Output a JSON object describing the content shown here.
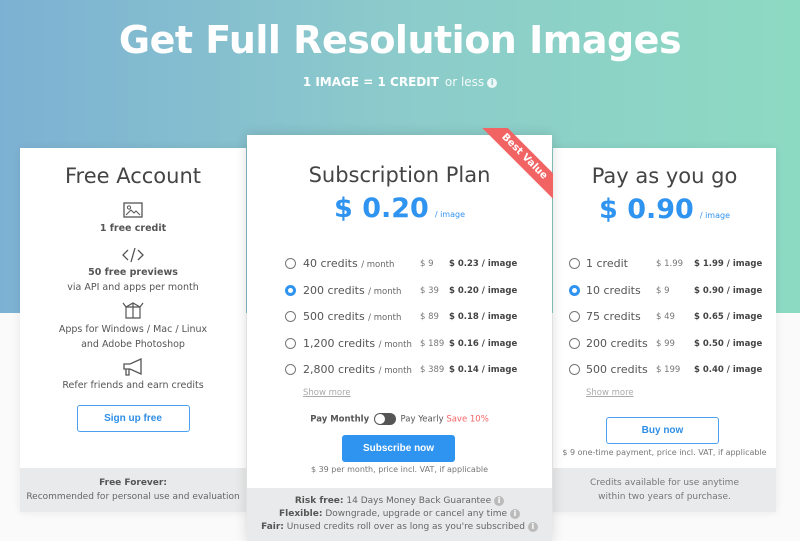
{
  "header": {
    "title": "Get Full Resolution Images",
    "subtitle_bold": "1 IMAGE = 1 CREDIT",
    "subtitle_rest": "or less",
    "info_icon": "info-icon"
  },
  "free": {
    "title": "Free Account",
    "features": [
      {
        "icon": "image-icon",
        "bold": "1 free credit",
        "text": ""
      },
      {
        "icon": "code-icon",
        "bold": "50 free previews",
        "text": "via API and apps per month"
      },
      {
        "icon": "box-icon",
        "bold": "",
        "text": "Apps for Windows / Mac / Linux",
        "text2": "and Adobe Photoshop"
      },
      {
        "icon": "megaphone-icon",
        "bold": "",
        "text": "Refer friends and earn credits"
      }
    ],
    "button": "Sign up free",
    "footer_bold": "Free Forever:",
    "footer_text": "Recommended for personal use and evaluation"
  },
  "subscription": {
    "title": "Subscription Plan",
    "price": "$ 0.20",
    "price_unit": "/ image",
    "ribbon": "Best Value",
    "options": [
      {
        "credits": "40 credits",
        "period": "/ month",
        "amount": "$ 9",
        "per": "$ 0.23 / image",
        "selected": false
      },
      {
        "credits": "200 credits",
        "period": "/ month",
        "amount": "$ 39",
        "per": "$ 0.20 / image",
        "selected": true
      },
      {
        "credits": "500 credits",
        "period": "/ month",
        "amount": "$ 89",
        "per": "$ 0.18 / image",
        "selected": false
      },
      {
        "credits": "1,200 credits",
        "period": "/ month",
        "amount": "$ 189",
        "per": "$ 0.16 / image",
        "selected": false
      },
      {
        "credits": "2,800 credits",
        "period": "/ month",
        "amount": "$ 389",
        "per": "$ 0.14 / image",
        "selected": false
      }
    ],
    "show_more": "Show more",
    "pay_monthly": "Pay Monthly",
    "pay_yearly": "Pay Yearly",
    "save": "Save 10%",
    "toggle_yearly": false,
    "button": "Subscribe now",
    "note": "$ 39 per month, price incl. VAT, if applicable",
    "footer": [
      {
        "bold": "Risk free:",
        "text": "14 Days Money Back Guarantee"
      },
      {
        "bold": "Flexible:",
        "text": "Downgrade, upgrade or cancel any time"
      },
      {
        "bold": "Fair:",
        "text": "Unused credits roll over as long as you're subscribed"
      }
    ]
  },
  "payg": {
    "title": "Pay as you go",
    "price": "$ 0.90",
    "price_unit": "/ image",
    "options": [
      {
        "credits": "1 credit",
        "amount": "$ 1.99",
        "per": "$ 1.99 / image",
        "selected": false
      },
      {
        "credits": "10 credits",
        "amount": "$ 9",
        "per": "$ 0.90 / image",
        "selected": true
      },
      {
        "credits": "75 credits",
        "amount": "$ 49",
        "per": "$ 0.65 / image",
        "selected": false
      },
      {
        "credits": "200 credits",
        "amount": "$ 99",
        "per": "$ 0.50 / image",
        "selected": false
      },
      {
        "credits": "500 credits",
        "amount": "$ 199",
        "per": "$ 0.40 / image",
        "selected": false
      }
    ],
    "show_more": "Show more",
    "button": "Buy now",
    "note": "$ 9 one-time payment, price incl. VAT, if applicable",
    "footer_line1": "Credits available for use anytime",
    "footer_line2": "within two years of purchase."
  },
  "colors": {
    "accent": "#2f93f0",
    "ribbon": "#f26363",
    "gradient_left": "#7db1d3",
    "gradient_right": "#8ddac2"
  }
}
